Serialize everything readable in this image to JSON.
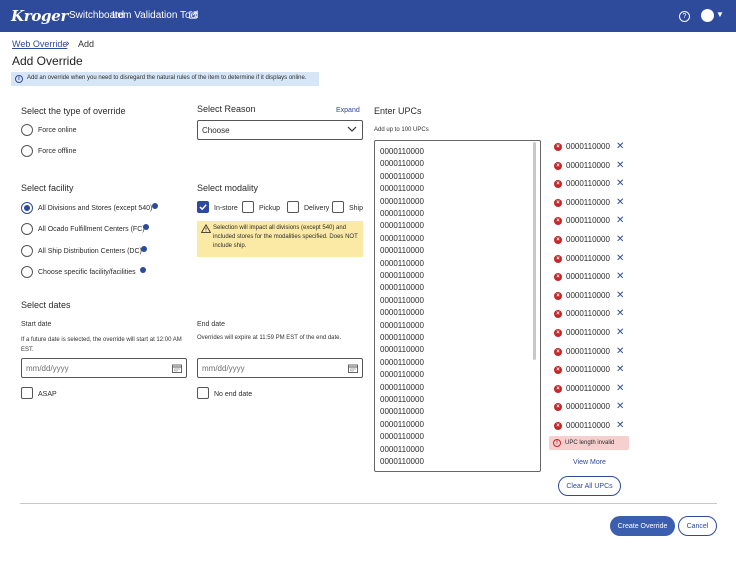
{
  "header": {
    "brand": "Kroger",
    "nav": [
      "Switchboard",
      "Item Validation Tool"
    ],
    "icons": [
      "external-link-icon",
      "help-icon",
      "avatar",
      "chevron-down-icon"
    ],
    "help_glyph": "?"
  },
  "breadcrumb": {
    "link": "Web Override",
    "separator": "›",
    "current": "Add"
  },
  "page_title": "Add Override",
  "info_banner": {
    "glyph": "i",
    "text": "Add an override when you need to disregard the natural rules of the item to determine if it displays online."
  },
  "override_type": {
    "title": "Select the type of override",
    "options": [
      "Force online",
      "Force offline"
    ]
  },
  "reason": {
    "title": "Select Reason",
    "expand": "Expand",
    "selected": "Choose"
  },
  "facility": {
    "title": "Select facility",
    "options": [
      "All Divisions and Stores (except 540)",
      "All Ocado Fulfillment Centers (FC)",
      "All Ship Distribution Centers (DC)",
      "Choose specific facility/facilities"
    ],
    "selected_index": 0
  },
  "modality": {
    "title": "Select modality",
    "options": [
      "In-store",
      "Pickup",
      "Delivery",
      "Ship"
    ],
    "checked": [
      true,
      false,
      false,
      false
    ],
    "warning": "Selection will impact all divisions (except 540) and included stores for the modalities specified. Does NOT include ship."
  },
  "dates": {
    "title": "Select dates",
    "start_label": "Start date",
    "start_help": "If a future date is selected, the override will start at 12:00 AM EST.",
    "end_label": "End date",
    "end_help": "Overrides will expire at 11:59 PM EST of the end date.",
    "placeholder": "mm/dd/yyyy",
    "asap": "ASAP",
    "no_end": "No end date"
  },
  "upcs": {
    "title": "Enter UPCs",
    "help": "Add up to 100 UPCs",
    "lines": [
      "0000110000",
      "0000110000",
      "0000110000",
      "0000110000",
      "0000110000",
      "0000110000",
      "0000110000",
      "0000110000",
      "0000110000",
      "0000110000",
      "0000110000",
      "0000110000",
      "0000110000",
      "0000110000",
      "0000110000",
      "0000110000",
      "0000110000",
      "0000110000",
      "0000110000",
      "0000110000",
      "0000110000",
      "0000110000",
      "0000110000",
      "0000110000",
      "0000110000",
      "0000110000"
    ],
    "chips": [
      "0000110000",
      "0000110000",
      "0000110000",
      "0000110000",
      "0000110000",
      "0000110000",
      "0000110000",
      "0000110000",
      "0000110000",
      "0000110000",
      "0000110000",
      "0000110000",
      "0000110000",
      "0000110000",
      "0000110000",
      "0000110000"
    ],
    "chip_error_glyph": "×",
    "chip_remove_glyph": "✕",
    "error_glyph": "!",
    "error": "UPC length invalid",
    "view_more": "View More",
    "clear_all": "Clear All UPCs"
  },
  "actions": {
    "create": "Create Override",
    "cancel": "Cancel"
  },
  "colors": {
    "header": "#2e4b9b",
    "accent": "#2e4b9b",
    "error": "#c62828",
    "warning_bg": "#fbeaa6",
    "info_bg": "#d6e6f6"
  }
}
